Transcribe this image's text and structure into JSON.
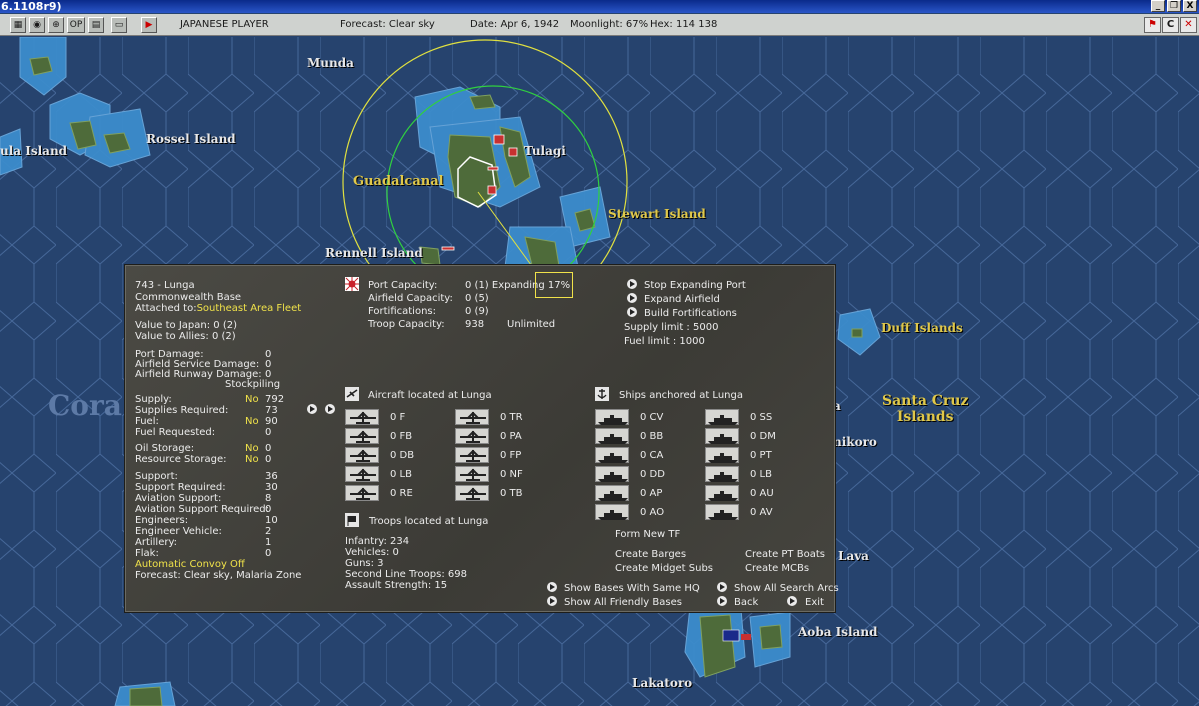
{
  "window": {
    "title": "6.1108r9)",
    "buttons": [
      "_",
      "❐",
      "X"
    ]
  },
  "toolbar": {
    "player": "JAPANESE PLAYER",
    "forecast": "Forecast: Clear sky",
    "date": "Date: Apr 6, 1942",
    "moonlight": "Moonlight: 67%",
    "hex": "Hex: 114 138",
    "op_label": "OP",
    "right_c": "C"
  },
  "map": {
    "labels": {
      "munda": "Munda",
      "rossel": "Rossel Island",
      "ula": "ula Island",
      "guadalcanal": "Guadalcanal",
      "tulagi": "Tulagi",
      "stewart": "Stewart Island",
      "rennell": "Rennell Island",
      "duff": "Duff Islands",
      "santa_cruz_1": "Santa Cruz",
      "santa_cruz_2": "Islands",
      "nikoro": "nikoro",
      "a": "a",
      "lava": "Lava",
      "aoba": "Aoba Island",
      "lakatoro": "Lakatoro",
      "coral": "Cora"
    }
  },
  "base": {
    "name": "743 - Lunga",
    "type": "Commonwealth Base",
    "attached_label": "Attached to:",
    "attached_value": "Southeast Area Fleet",
    "value_japan": "Value to Japan: 0 (2)",
    "value_allies": "Value to Allies: 0 (2)"
  },
  "damage": [
    {
      "label": "Port Damage:",
      "value": "0"
    },
    {
      "label": "Airfield Service Damage:",
      "value": "0"
    },
    {
      "label": "Airfield Runway Damage:",
      "value": "0"
    }
  ],
  "stockpiling_header": "Stockpiling",
  "stocks": [
    {
      "label": "Supply:",
      "flag": "No",
      "value": "792"
    },
    {
      "label": "Supplies Required:",
      "flag": "",
      "value": "73"
    },
    {
      "label": "Fuel:",
      "flag": "No",
      "value": "90"
    },
    {
      "label": "Fuel Requested:",
      "flag": "",
      "value": "0"
    },
    {
      "label": "Oil Storage:",
      "flag": "No",
      "value": "0"
    },
    {
      "label": "Resource Storage:",
      "flag": "No",
      "value": "0"
    }
  ],
  "support": [
    {
      "label": "Support:",
      "value": "36"
    },
    {
      "label": "Support Required:",
      "value": "30"
    },
    {
      "label": "Aviation Support:",
      "value": "8"
    },
    {
      "label": "Aviation Support Required:",
      "value": "0"
    },
    {
      "label": "Engineers:",
      "value": "10"
    },
    {
      "label": "Engineer Vehicle:",
      "value": "2"
    },
    {
      "label": "Artillery:",
      "value": "1"
    },
    {
      "label": "Flak:",
      "value": "0"
    }
  ],
  "convoy": "Automatic Convoy Off",
  "forecast_line": "Forecast: Clear sky, Malaria Zone",
  "capacity": [
    {
      "label": "Port Capacity:",
      "value": "0 (1) Expanding 17%"
    },
    {
      "label": "Airfield Capacity:",
      "value": "0 (5)"
    },
    {
      "label": "Fortifications:",
      "value": "0 (9)"
    },
    {
      "label": "Troop Capacity:",
      "value": "938",
      "extra": "Unlimited"
    }
  ],
  "actions": {
    "stop_port": "Stop Expanding Port",
    "expand_airfield": "Expand Airfield",
    "build_fort": "Build Fortifications",
    "supply_limit": "Supply limit : 5000",
    "fuel_limit": "Fuel limit : 1000"
  },
  "aircraft": {
    "header": "Aircraft located at Lunga",
    "left": [
      "0 F",
      "0 FB",
      "0 DB",
      "0 LB",
      "0 RE"
    ],
    "right": [
      "0 TR",
      "0 PA",
      "0 FP",
      "0 NF",
      "0 TB"
    ]
  },
  "ships": {
    "header": "Ships anchored at Lunga",
    "left": [
      "0 CV",
      "0 BB",
      "0 CA",
      "0 DD",
      "0 AP",
      "0 AO"
    ],
    "right": [
      "0 SS",
      "0 DM",
      "0 PT",
      "0 LB",
      "0 AU",
      "0 AV"
    ],
    "form_tf": "Form New TF",
    "create_barges": "Create Barges",
    "create_pt": "Create PT Boats",
    "create_midget": "Create Midget Subs",
    "create_mcb": "Create MCBs"
  },
  "troops": {
    "header": "Troops located at Lunga",
    "lines": [
      "Infantry: 234",
      "Vehicles: 0",
      "Guns: 3",
      "Second Line Troops: 698",
      "Assault Strength: 15"
    ]
  },
  "bottom": {
    "same_hq": "Show Bases With Same HQ",
    "friendly": "Show All Friendly Bases",
    "search_arcs": "Show All Search Arcs",
    "back": "Back",
    "exit": "Exit"
  },
  "colors": {
    "ocean": "#26436e",
    "hex_line": "#3a5c8e",
    "shallow": "#3f8fca",
    "land": "#4d6a3c",
    "dialog_bg": "#44433d",
    "highlight": "#f0e24a"
  }
}
